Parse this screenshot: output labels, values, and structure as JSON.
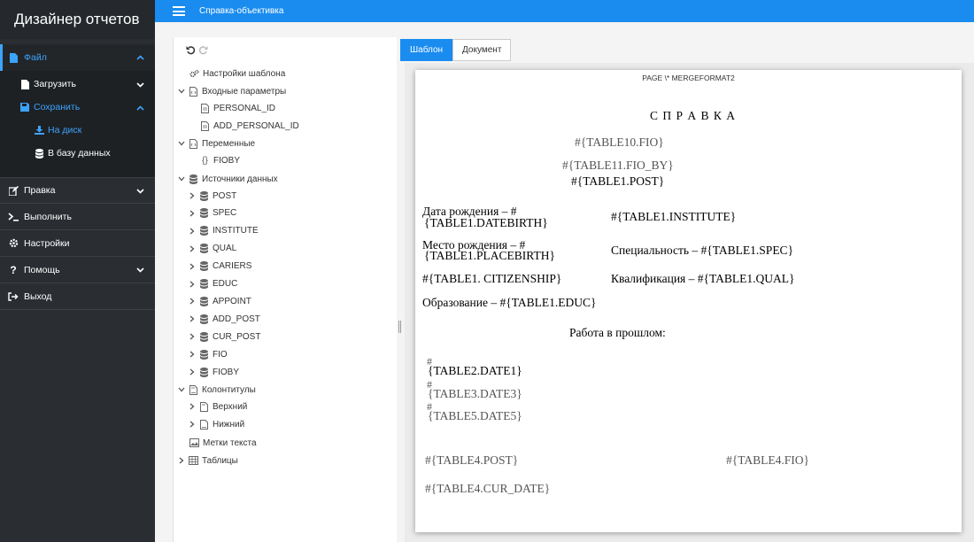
{
  "app": {
    "title": "Дизайнер отчетов",
    "topbar_title": "Справка-объективка"
  },
  "sidebar": {
    "file": "Файл",
    "load": "Загрузить",
    "save": "Сохранить",
    "to_disk": "На диск",
    "to_db": "В базу данных",
    "edit": "Правка",
    "run": "Выполнить",
    "settings": "Настройки",
    "help": "Помощь",
    "exit": "Выход"
  },
  "tree": {
    "template_settings": "Настройки шаблона",
    "input_params": "Входные параметры",
    "params": [
      "PERSONAL_ID",
      "ADD_PERSONAL_ID"
    ],
    "variables": "Переменные",
    "vars": [
      "FIOBY"
    ],
    "datasources": "Источники данных",
    "sources": [
      "POST",
      "SPEC",
      "INSTITUTE",
      "QUAL",
      "CARIERS",
      "EDUC",
      "APPOINT",
      "ADD_POST",
      "CUR_POST",
      "FIO",
      "FIOBY"
    ],
    "headers_footers": "Колонтитулы",
    "header": "Верхний",
    "footer": "Нижний",
    "text_labels": "Метки текста",
    "tables": "Таблицы"
  },
  "tabs": {
    "template": "Шаблон",
    "document": "Документ"
  },
  "document": {
    "page_field": "PAGE \\* MERGEFORMAT2",
    "heading": "С П Р А В К А",
    "fio": "#{TABLE10.FIO}",
    "fio_by": "#{TABLE11.FIO_BY}",
    "post": "#{TABLE1.POST}",
    "birth_label": "Дата рождения – #",
    "birth_value": "{TABLE1.DATEBIRTH}",
    "institute": "#{TABLE1.INSTITUTE}",
    "place_label": "Место рождения – #",
    "place_value": "{TABLE1.PLACEBIRTH}",
    "spec": "Специальность – #{TABLE1.SPEC}",
    "citizenship": "#{TABLE1. CITIZENSHIP}",
    "qual": "Квалификация – #{TABLE1.QUAL}",
    "educ": "Образование – #{TABLE1.EDUC}",
    "past_work": "Работа в прошлом:",
    "hash": "#",
    "date1": "{TABLE2.DATE1}",
    "date3": "{TABLE3.DATE3}",
    "date5": "{TABLE5.DATE5}",
    "post4": "#{TABLE4.POST}",
    "fio4": "#{TABLE4.FIO}",
    "cur_date": "#{TABLE4.CUR_DATE}"
  }
}
